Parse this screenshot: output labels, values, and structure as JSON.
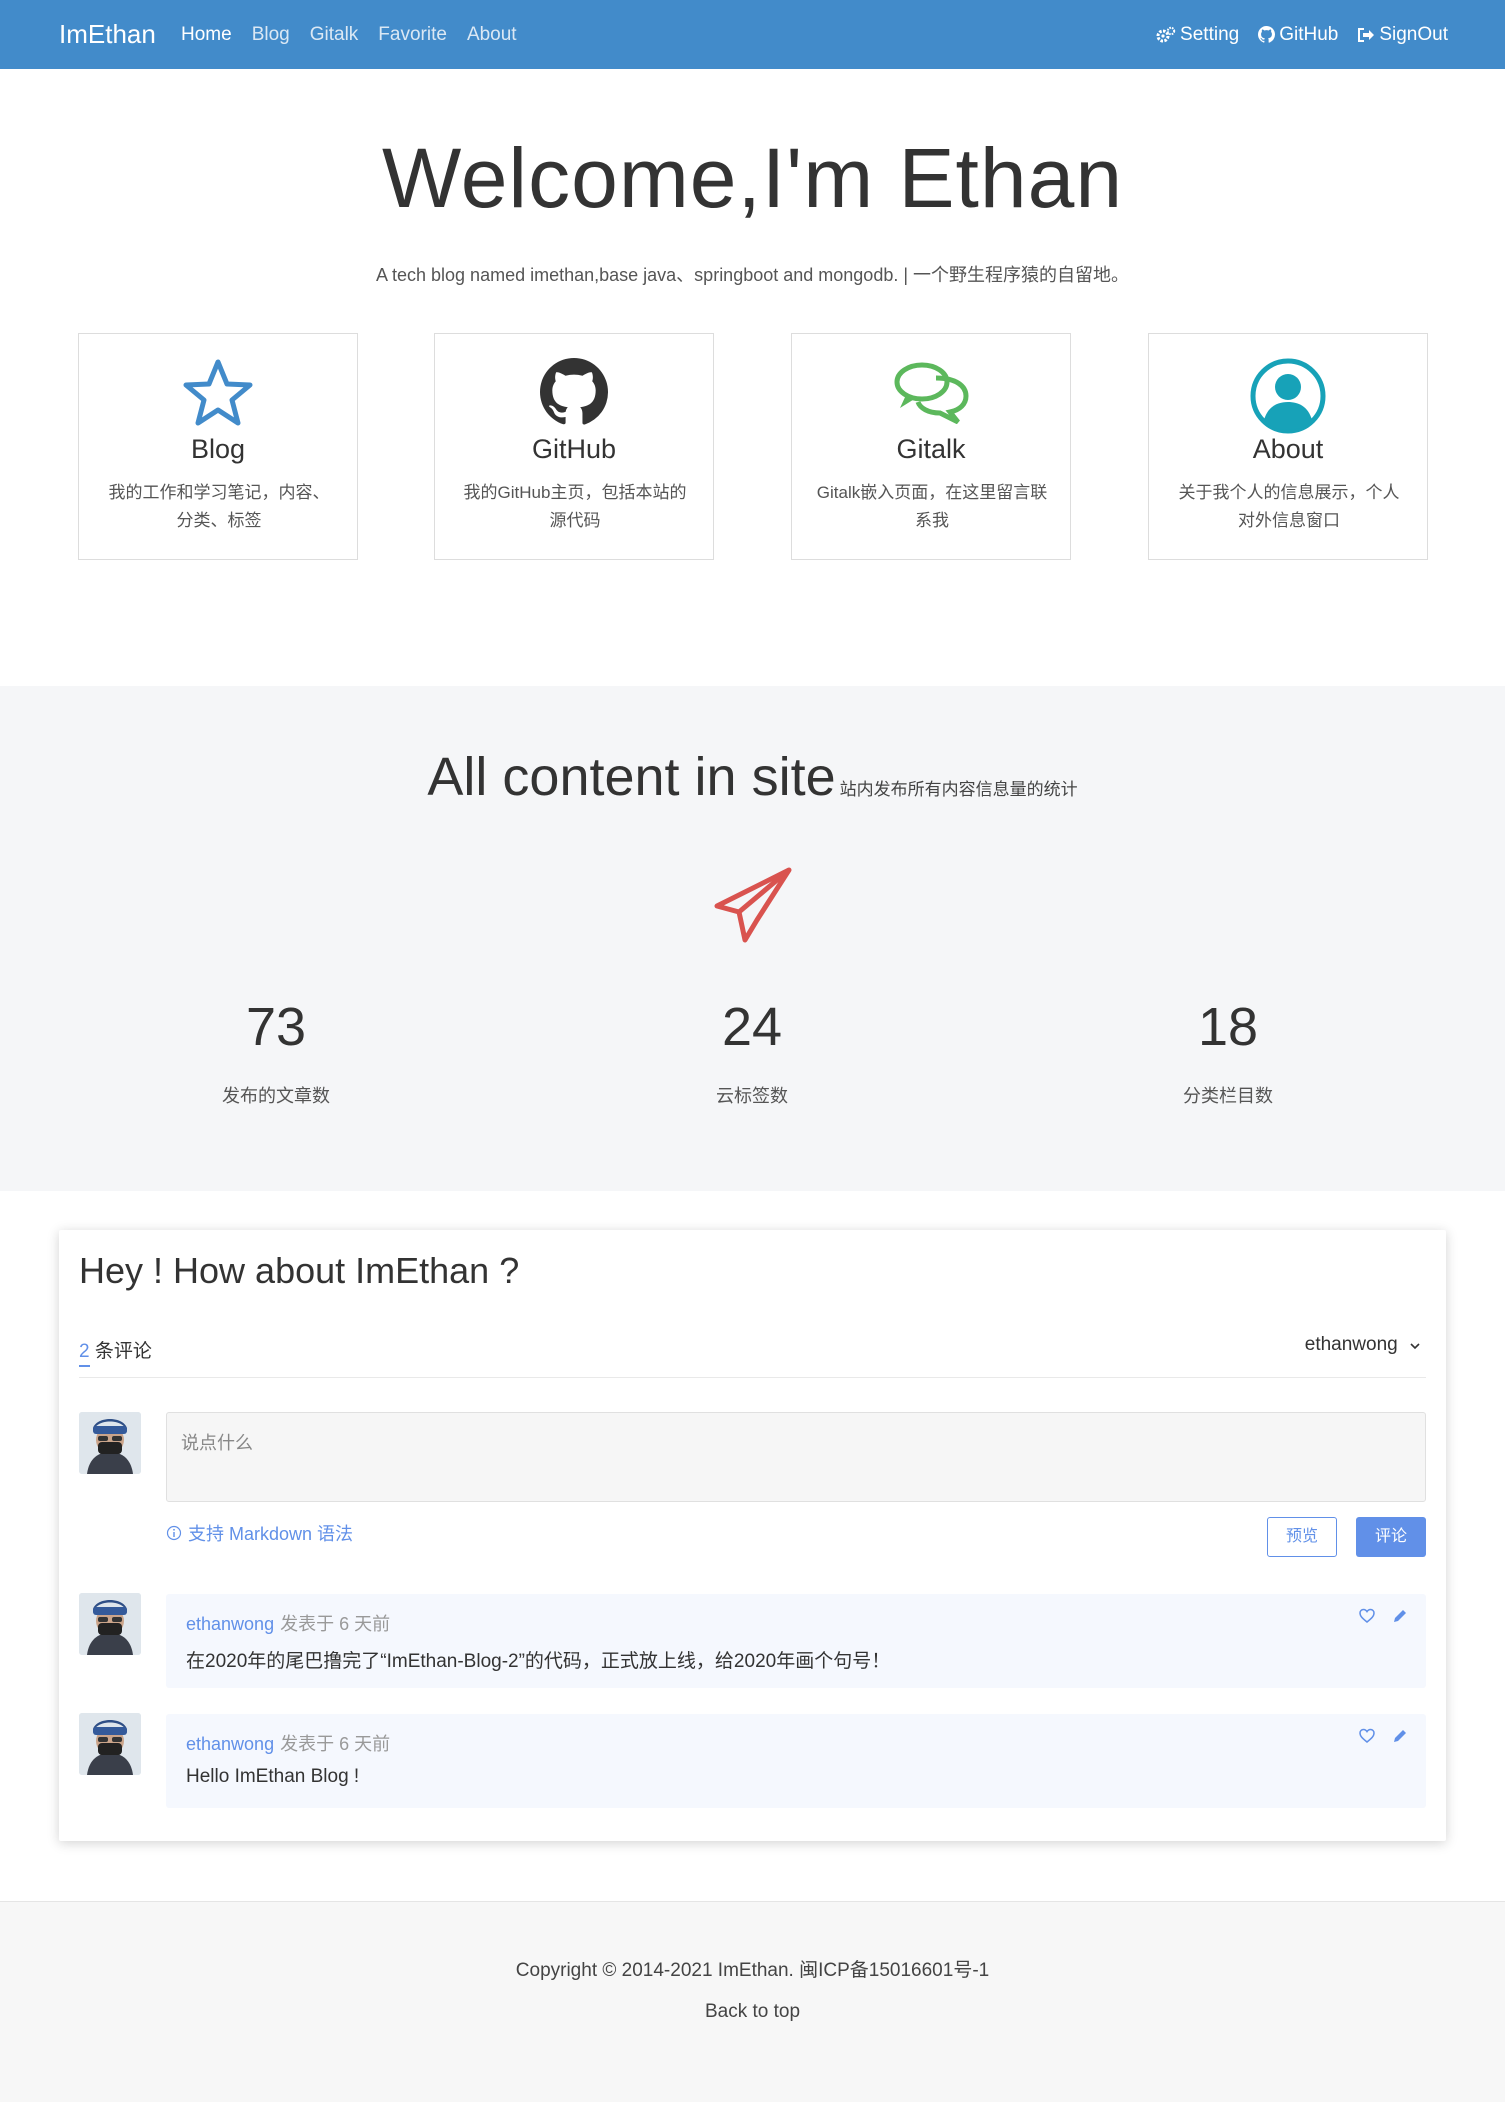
{
  "navbar": {
    "brand": "ImEthan",
    "links": [
      "Home",
      "Blog",
      "Gitalk",
      "Favorite",
      "About"
    ],
    "right": [
      "Setting",
      "GitHub",
      "SignOut"
    ]
  },
  "hero": {
    "title": "Welcome,I'm Ethan",
    "subtitle": "A tech blog named imethan,base java、springboot and mongodb. | 一个野生程序猿的自留地。"
  },
  "features": [
    {
      "icon": "star-icon",
      "title": "Blog",
      "desc": "我的工作和学习笔记，内容、分类、标签",
      "color": "#428bca"
    },
    {
      "icon": "github-icon",
      "title": "GitHub",
      "desc": "我的GitHub主页，包括本站的源代码",
      "color": "#333333"
    },
    {
      "icon": "chat-icon",
      "title": "Gitalk",
      "desc": "Gitalk嵌入页面，在这里留言联系我",
      "color": "#5cb85c"
    },
    {
      "icon": "user-circle-icon",
      "title": "About",
      "desc": "关于我个人的信息展示，个人对外信息窗口",
      "color": "#17a2b8"
    }
  ],
  "stats": {
    "title": "All content in site",
    "subtitle": "站内发布所有内容信息量的统计",
    "items": [
      {
        "value": "73",
        "label": "发布的文章数"
      },
      {
        "value": "24",
        "label": "云标签数"
      },
      {
        "value": "18",
        "label": "分类栏目数"
      }
    ],
    "icon_color": "#d9534f"
  },
  "comments": {
    "title": "Hey ! How about ImEthan ?",
    "count": "2",
    "count_suffix": " 条评论",
    "user": "ethanwong",
    "placeholder": "说点什么",
    "markdown_tip": "支持 Markdown 语法",
    "preview_label": "预览",
    "submit_label": "评论",
    "accent": "#6190e8",
    "list": [
      {
        "author": "ethanwong",
        "time": "发表于  6 天前",
        "body": "在2020年的尾巴撸完了“ImEthan-Blog-2”的代码，正式放上线，给2020年画个句号！"
      },
      {
        "author": "ethanwong",
        "time": "发表于  6 天前",
        "body": "Hello ImEthan Blog !"
      }
    ]
  },
  "footer": {
    "copyright": "Copyright © 2014-2021 ImEthan. 闽ICP备15016601号-1",
    "back_to_top": "Back to top"
  }
}
